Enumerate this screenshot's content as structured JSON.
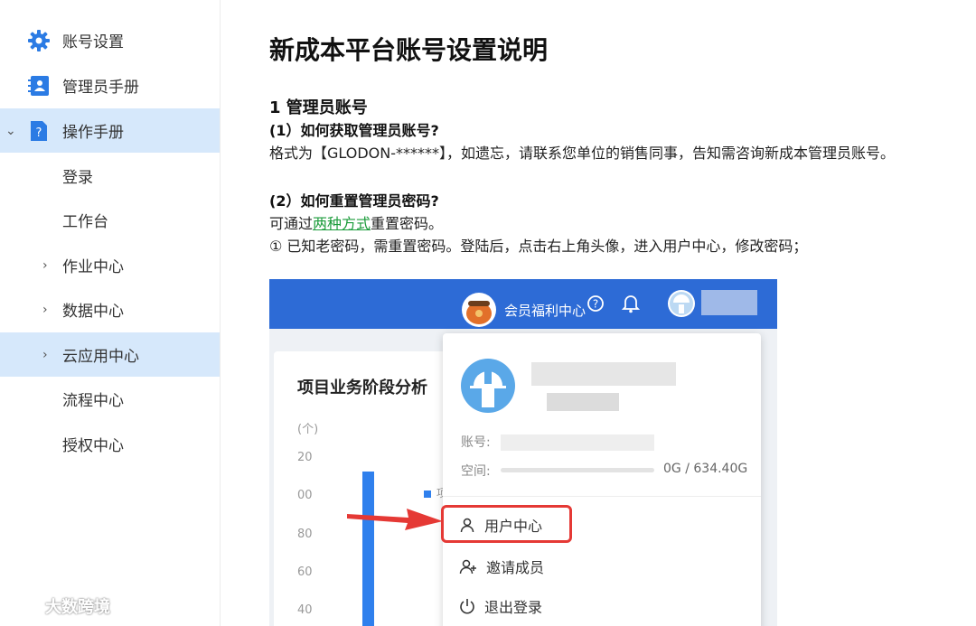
{
  "sidebar": {
    "items": [
      {
        "label": "账号设置",
        "icon": "gear-icon"
      },
      {
        "label": "管理员手册",
        "icon": "contact-card-icon"
      },
      {
        "label": "操作手册",
        "icon": "help-doc-icon"
      },
      {
        "label": "登录"
      },
      {
        "label": "工作台"
      },
      {
        "label": "作业中心"
      },
      {
        "label": "数据中心"
      },
      {
        "label": "云应用中心"
      },
      {
        "label": "流程中心"
      },
      {
        "label": "授权中心"
      }
    ],
    "watermark": "大数跨境"
  },
  "doc": {
    "title": "新成本平台账号设置说明",
    "section1": "1 管理员账号",
    "q1": "(1）如何获取管理员账号?",
    "a1": "格式为【GLODON-******】，如遗忘，请联系您单位的销售同事，告知需咨询新成本管理员账号。",
    "q2": "(2）如何重置管理员密码?",
    "a2_pre": "可通过",
    "a2_link": "两种方式",
    "a2_post": "重置密码。",
    "step1": "① 已知老密码，需重置密码。登陆后，点击右上角头像，进入用户中心，修改密码；"
  },
  "screenshot": {
    "topbar": {
      "vip_label": "会员福利中心"
    },
    "chart_card": {
      "title": "项目业务阶段分析",
      "unit": "(个)",
      "legend_fragment": "项",
      "ticks": [
        "20",
        "00",
        "80",
        "60",
        "40"
      ]
    },
    "profile_menu": {
      "account_label": "账号:",
      "space_label": "空间:",
      "storage": "0G / 634.40G",
      "items": [
        {
          "label": "用户中心",
          "icon": "user-icon"
        },
        {
          "label": "邀请成员",
          "icon": "add-user-icon"
        },
        {
          "label": "退出登录",
          "icon": "power-icon"
        }
      ]
    }
  },
  "colors": {
    "accent": "#2d6bd6",
    "sidebar_active": "#d6e8fb",
    "highlight_red": "#e53935",
    "link_green": "#1a9b3a"
  }
}
